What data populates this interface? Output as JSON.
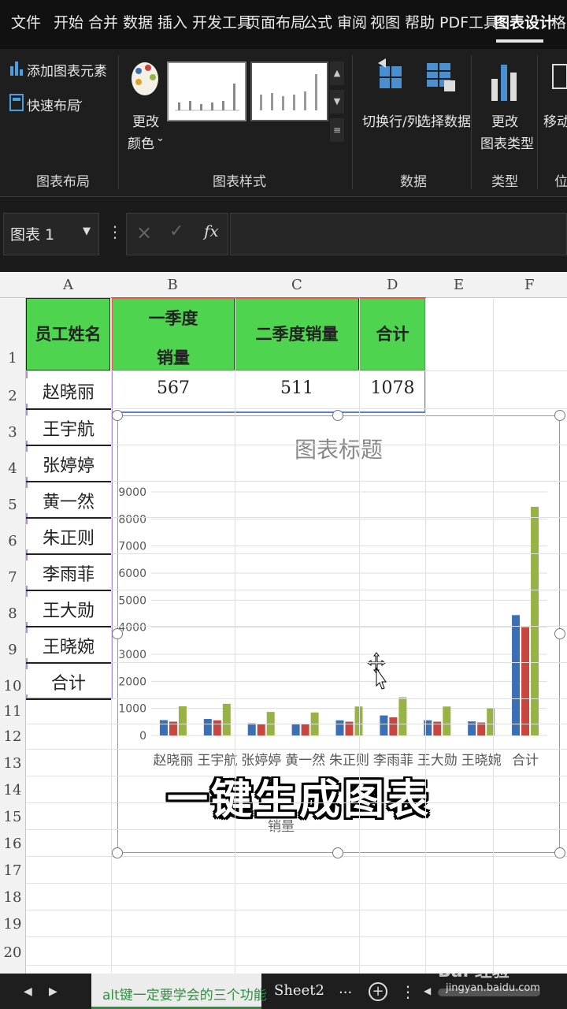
{
  "menu": [
    "文件",
    "开始",
    "合并",
    "数据",
    "插入",
    "开发工具",
    "页面布局",
    "公式",
    "审阅",
    "视图",
    "帮助",
    "PDF工具",
    "图表设计",
    "格"
  ],
  "ribbon": {
    "add_chart_element": "添加图表元素",
    "quick_layout": "快速布局",
    "change_colors_1": "更改",
    "change_colors_2": "颜色",
    "switch_row_col": "切换行/列",
    "select_data": "选择数据",
    "change_type_1": "更改",
    "change_type_2": "图表类型",
    "move_1": "移动",
    "groups": {
      "layout": "图表布局",
      "styles": "图表样式",
      "data": "数据",
      "type": "类型",
      "location": "位"
    }
  },
  "formula_bar": {
    "name_box": "图表 1",
    "cancel": "×",
    "confirm": "✓",
    "fx": "fx",
    "value": ""
  },
  "columns": [
    "A",
    "B",
    "C",
    "D",
    "E",
    "F"
  ],
  "rows": [
    "1",
    "2",
    "3",
    "4",
    "5",
    "6",
    "7",
    "8",
    "9",
    "10",
    "11",
    "12",
    "13",
    "14",
    "15",
    "16",
    "17",
    "18",
    "19",
    "20"
  ],
  "table": {
    "headers": [
      "员工姓名",
      "一季度",
      "销量",
      "二季度销量",
      "合计"
    ],
    "names": [
      "赵晓丽",
      "王宇航",
      "张婷婷",
      "黄一然",
      "朱正则",
      "李雨菲",
      "王大勋",
      "王晓婉",
      "合计"
    ],
    "row2": [
      "567",
      "511",
      "1078"
    ]
  },
  "chart_data": {
    "type": "bar",
    "title": "图表标题",
    "categories": [
      "赵晓丽",
      "王宇航",
      "张婷婷",
      "黄一然",
      "朱正则",
      "李雨菲",
      "王大勋",
      "王晓婉",
      "合计"
    ],
    "series": [
      {
        "values": [
          567,
          610,
          450,
          440,
          560,
          740,
          560,
          520,
          4447
        ]
      },
      {
        "values": [
          511,
          560,
          420,
          410,
          510,
          670,
          510,
          480,
          4000
        ]
      },
      {
        "values": [
          1078,
          1170,
          870,
          850,
          1070,
          1410,
          1070,
          1000,
          8450
        ]
      }
    ],
    "colors": [
      "#3a6fb5",
      "#c8463d",
      "#98b345"
    ],
    "ylim": [
      0,
      9000
    ],
    "yticks": [
      "0",
      "1000",
      "2000",
      "3000",
      "4000",
      "5000",
      "6000",
      "7000",
      "8000",
      "9000"
    ],
    "legend_fragment": "销量",
    "grid": true
  },
  "caption": "一键生成图表",
  "tabs": {
    "active": "alt键一定要学会的三个功能",
    "sheet2": "Sheet2",
    "more": "...",
    "add": "+",
    "watermark": "Bai 经验",
    "watermark_url": "jingyan.baidu.com"
  }
}
